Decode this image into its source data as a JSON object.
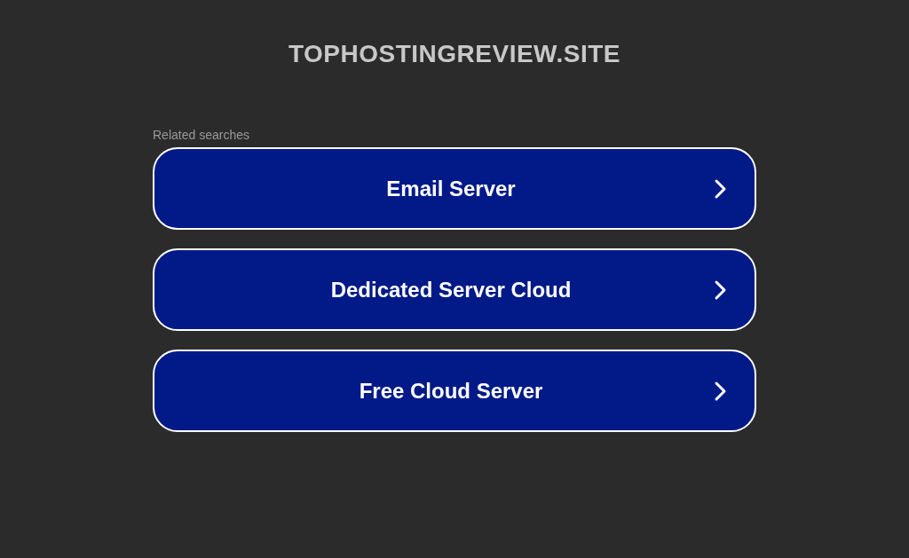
{
  "header": {
    "title": "TOPHOSTINGREVIEW.SITE"
  },
  "related": {
    "heading": "Related searches",
    "links": [
      {
        "label": "Email Server"
      },
      {
        "label": "Dedicated Server Cloud"
      },
      {
        "label": "Free Cloud Server"
      }
    ]
  }
}
